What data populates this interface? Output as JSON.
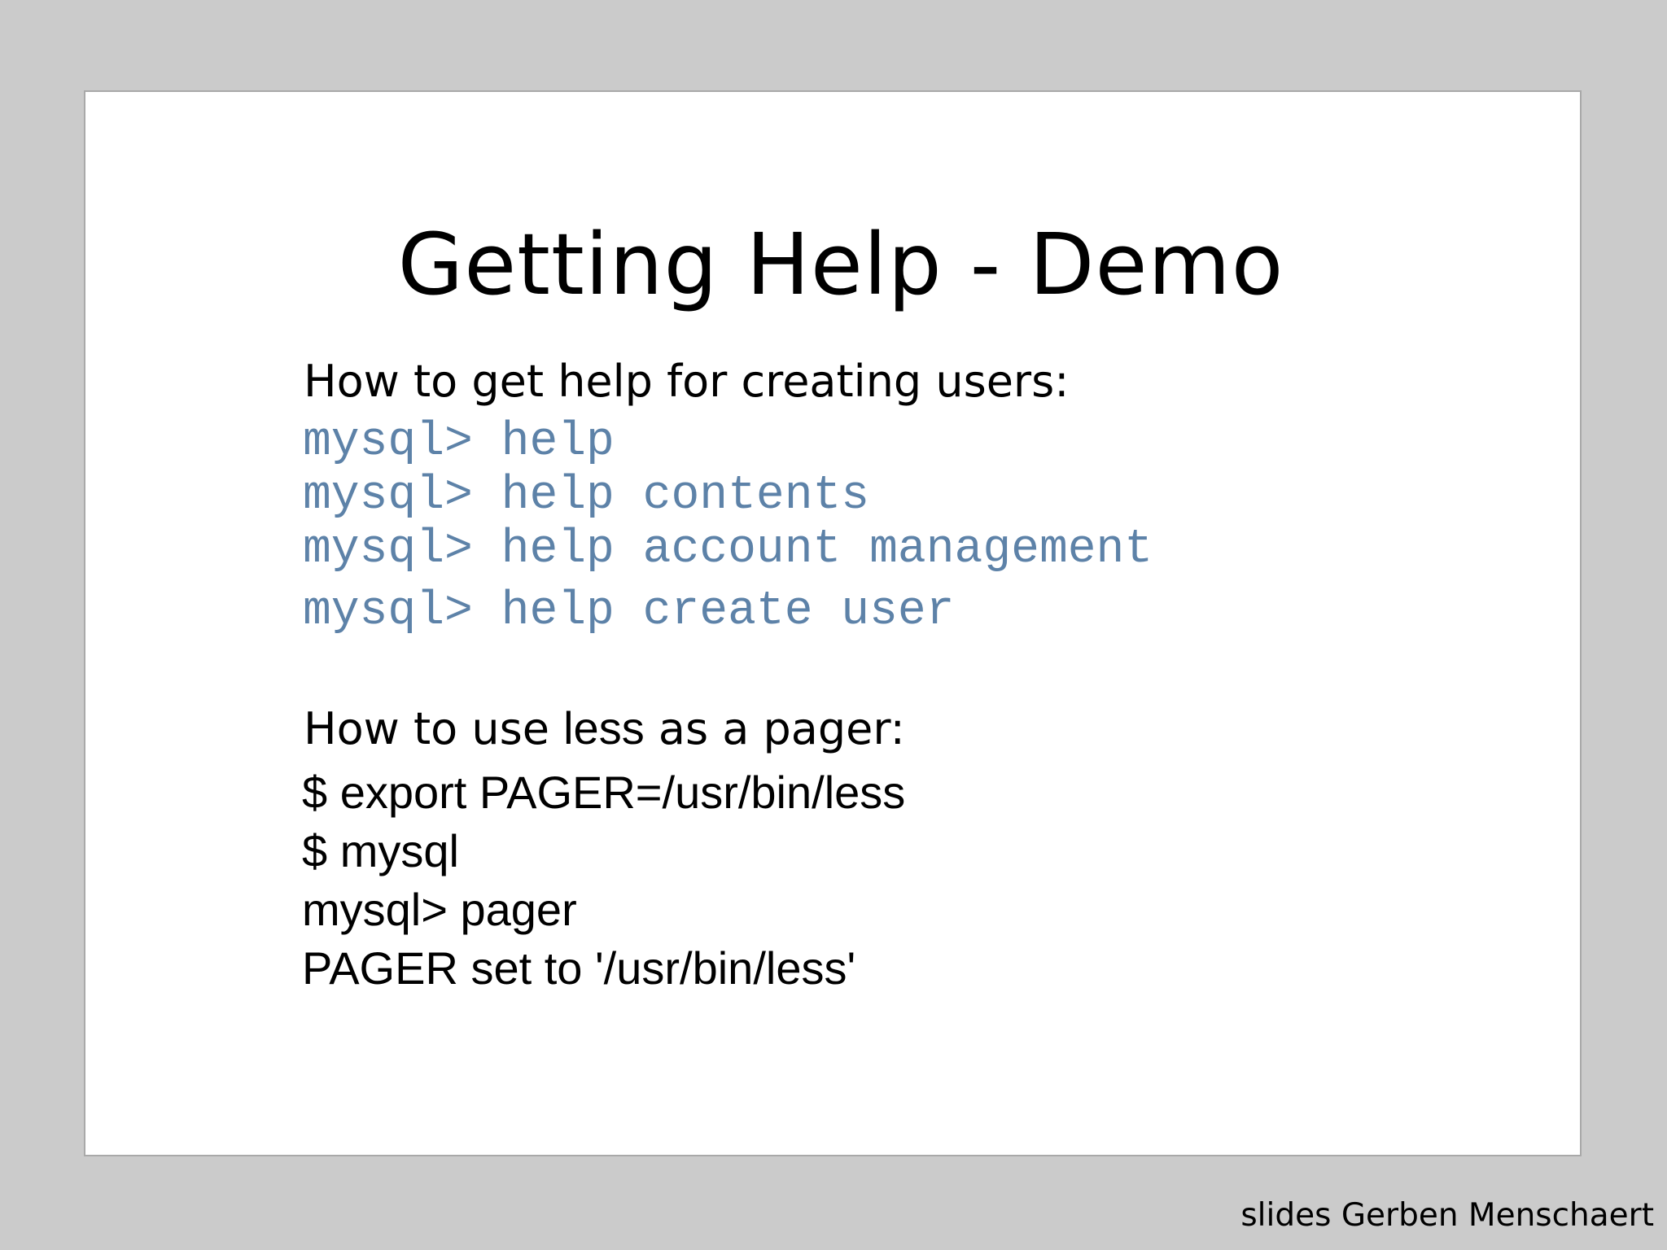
{
  "slide": {
    "title": "Getting Help - Demo",
    "section1": {
      "heading": "How to get help for creating users:",
      "commands": [
        "mysql> help",
        "mysql> help contents",
        "mysql> help account management",
        "mysql> help create user"
      ]
    },
    "section2": {
      "heading_before": "How to use ",
      "heading_cmd": "less",
      "heading_after": " as a pager:",
      "commands": [
        "$ export PAGER=/usr/bin/less",
        "$ mysql",
        "mysql> pager",
        "PAGER set to '/usr/bin/less'"
      ]
    }
  },
  "footer": {
    "credit": "slides Gerben Menschaert"
  },
  "colors": {
    "background": "#cbcbcb",
    "slide": "#ffffff",
    "command_blue": "#5d82a8"
  }
}
